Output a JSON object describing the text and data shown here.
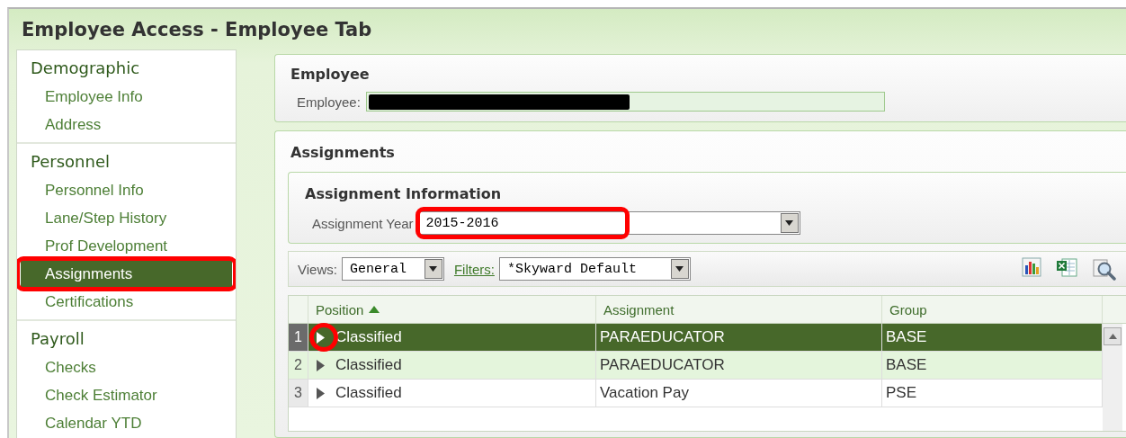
{
  "window": {
    "title": "Employee Access - Employee Tab"
  },
  "sidebar": {
    "sections": [
      {
        "heading": "Demographic",
        "items": [
          {
            "label": "Employee Info",
            "selected": false,
            "highlighted": false
          },
          {
            "label": "Address",
            "selected": false,
            "highlighted": false
          }
        ]
      },
      {
        "heading": "Personnel",
        "items": [
          {
            "label": "Personnel Info",
            "selected": false,
            "highlighted": false
          },
          {
            "label": "Lane/Step History",
            "selected": false,
            "highlighted": false
          },
          {
            "label": "Prof Development",
            "selected": false,
            "highlighted": false
          },
          {
            "label": "Assignments",
            "selected": true,
            "highlighted": true
          },
          {
            "label": "Certifications",
            "selected": false,
            "highlighted": false
          }
        ]
      },
      {
        "heading": "Payroll",
        "items": [
          {
            "label": "Checks",
            "selected": false,
            "highlighted": false
          },
          {
            "label": "Check Estimator",
            "selected": false,
            "highlighted": false
          },
          {
            "label": "Calendar YTD",
            "selected": false,
            "highlighted": false
          }
        ]
      }
    ]
  },
  "employee_panel": {
    "title": "Employee",
    "field_label": "Employee:"
  },
  "assignments_panel": {
    "title": "Assignments",
    "info": {
      "title": "Assignment Information",
      "year_label": "Assignment Year",
      "year_value": "2015-2016",
      "year_highlighted": true
    },
    "toolbar": {
      "views_label": "Views:",
      "views_value": "General",
      "filters_label": "Filters:",
      "filters_value": "*Skyward Default"
    },
    "table": {
      "columns": [
        {
          "label": "Position",
          "sorted": true
        },
        {
          "label": "Assignment",
          "sorted": false
        },
        {
          "label": "Group",
          "sorted": false
        }
      ],
      "rows": [
        {
          "number": "1",
          "position": "Classified",
          "assignment": "PARAEDUCATOR",
          "group": "BASE",
          "selected": true,
          "highlighted": true
        },
        {
          "number": "2",
          "position": "Classified",
          "assignment": "PARAEDUCATOR",
          "group": "BASE",
          "selected": false,
          "highlighted": false
        },
        {
          "number": "3",
          "position": "Classified",
          "assignment": "Vacation Pay",
          "group": "PSE",
          "selected": false,
          "highlighted": false
        }
      ]
    }
  }
}
